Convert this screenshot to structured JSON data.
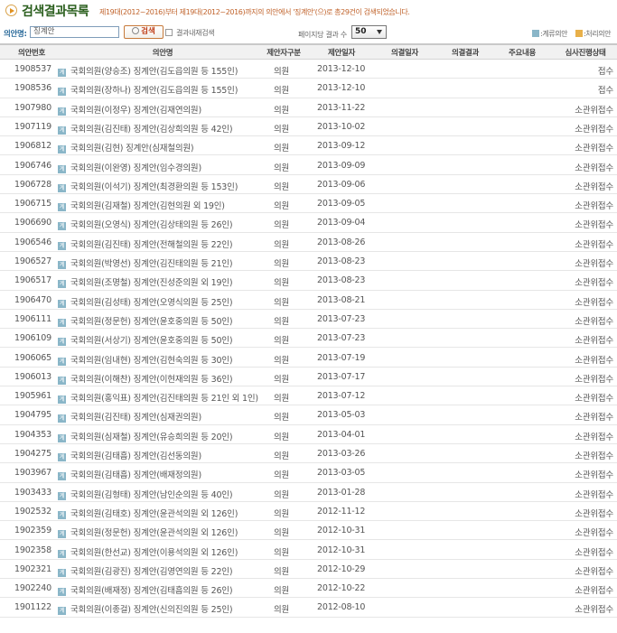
{
  "header": {
    "title": "검색결과목록",
    "description": "제19대(2012~2016)부터 제19대(2012~2016)까지의 의안에서 '징계안'(으)로 총29건이 검색되었습니다."
  },
  "search": {
    "label": "의안명:",
    "value": "징계안",
    "button_label": "검색",
    "within_label": "결과내재검색",
    "per_page_label": "페이지당 결과 수",
    "per_page_value": "50",
    "legend_pending_icon": "계",
    "legend_pending": ":계류의안",
    "legend_processed_icon": "처",
    "legend_processed": ":처리의안"
  },
  "colors": {
    "title": "#2b5f1e",
    "description": "#c0622a",
    "pending_icon": "#8ab6c8",
    "processed_icon": "#e8b04a"
  },
  "table": {
    "columns": [
      "의안번호",
      "의안명",
      "제안자구분",
      "제안일자",
      "의결일자",
      "의결결과",
      "주요내용",
      "심사진행상태"
    ],
    "rows": [
      {
        "no": "1908537",
        "icon": "계",
        "name": "국회의원(양승조) 징계안(김도읍의원 등 155인)",
        "type": "의원",
        "date": "2013-12-10",
        "status": "접수"
      },
      {
        "no": "1908536",
        "icon": "계",
        "name": "국회의원(장하나) 징계안(김도읍의원 등 155인)",
        "type": "의원",
        "date": "2013-12-10",
        "status": "접수"
      },
      {
        "no": "1907980",
        "icon": "계",
        "name": "국회의원(이정우) 징계안(김재연의원)",
        "type": "의원",
        "date": "2013-11-22",
        "status": "소관위접수"
      },
      {
        "no": "1907119",
        "icon": "계",
        "name": "국회의원(김진태) 징계안(김상희의원 등 42인)",
        "type": "의원",
        "date": "2013-10-02",
        "status": "소관위접수"
      },
      {
        "no": "1906812",
        "icon": "계",
        "name": "국회의원(김현) 징계안(심재철의원)",
        "type": "의원",
        "date": "2013-09-12",
        "status": "소관위접수"
      },
      {
        "no": "1906746",
        "icon": "계",
        "name": "국회의원(이완영) 징계안(임수경의원)",
        "type": "의원",
        "date": "2013-09-09",
        "status": "소관위접수"
      },
      {
        "no": "1906728",
        "icon": "계",
        "name": "국회의원(이석기) 징계안(최경환의원 등 153인)",
        "type": "의원",
        "date": "2013-09-06",
        "status": "소관위접수"
      },
      {
        "no": "1906715",
        "icon": "계",
        "name": "국회의원(김재철) 징계안(김현의원 외 19인)",
        "type": "의원",
        "date": "2013-09-05",
        "status": "소관위접수"
      },
      {
        "no": "1906690",
        "icon": "계",
        "name": "국회의원(오영식) 징계안(김상태의원 등 26인)",
        "type": "의원",
        "date": "2013-09-04",
        "status": "소관위접수"
      },
      {
        "no": "1906546",
        "icon": "계",
        "name": "국회의원(김진태) 징계안(전해철의원 등 22인)",
        "type": "의원",
        "date": "2013-08-26",
        "status": "소관위접수"
      },
      {
        "no": "1906527",
        "icon": "계",
        "name": "국회의원(박영선) 징계안(김진태의원 등 21인)",
        "type": "의원",
        "date": "2013-08-23",
        "status": "소관위접수"
      },
      {
        "no": "1906517",
        "icon": "계",
        "name": "국회의원(조명철) 징계안(진성준의원 외 19인)",
        "type": "의원",
        "date": "2013-08-23",
        "status": "소관위접수"
      },
      {
        "no": "1906470",
        "icon": "계",
        "name": "국회의원(김성태) 징계안(오영식의원 등 25인)",
        "type": "의원",
        "date": "2013-08-21",
        "status": "소관위접수"
      },
      {
        "no": "1906111",
        "icon": "계",
        "name": "국회의원(정문헌) 징계안(윤호중의원 등 50인)",
        "type": "의원",
        "date": "2013-07-23",
        "status": "소관위접수"
      },
      {
        "no": "1906109",
        "icon": "계",
        "name": "국회의원(서상기) 징계안(윤호중의원 등 50인)",
        "type": "의원",
        "date": "2013-07-23",
        "status": "소관위접수"
      },
      {
        "no": "1906065",
        "icon": "계",
        "name": "국회의원(임내현) 징계안(김현숙의원 등 30인)",
        "type": "의원",
        "date": "2013-07-19",
        "status": "소관위접수"
      },
      {
        "no": "1906013",
        "icon": "계",
        "name": "국회의원(이해찬) 징계안(이현재의원 등 36인)",
        "type": "의원",
        "date": "2013-07-17",
        "status": "소관위접수"
      },
      {
        "no": "1905961",
        "icon": "계",
        "name": "국회의원(홍익표) 징계안(김진태의원 등 21인 외 1인)",
        "type": "의원",
        "date": "2013-07-12",
        "status": "소관위접수"
      },
      {
        "no": "1904795",
        "icon": "계",
        "name": "국회의원(김진태) 징계안(심재권의원)",
        "type": "의원",
        "date": "2013-05-03",
        "status": "소관위접수"
      },
      {
        "no": "1904353",
        "icon": "계",
        "name": "국회의원(심재철) 징계안(유승희의원 등 20인)",
        "type": "의원",
        "date": "2013-04-01",
        "status": "소관위접수"
      },
      {
        "no": "1904275",
        "icon": "계",
        "name": "국회의원(김태흠) 징계안(김선동의원)",
        "type": "의원",
        "date": "2013-03-26",
        "status": "소관위접수"
      },
      {
        "no": "1903967",
        "icon": "계",
        "name": "국회의원(김태흠) 징계안(배재정의원)",
        "type": "의원",
        "date": "2013-03-05",
        "status": "소관위접수"
      },
      {
        "no": "1903433",
        "icon": "계",
        "name": "국회의원(김형태) 징계안(남인순의원 등 40인)",
        "type": "의원",
        "date": "2013-01-28",
        "status": "소관위접수"
      },
      {
        "no": "1902532",
        "icon": "계",
        "name": "국회의원(김태호) 징계안(윤관석의원 외 126인)",
        "type": "의원",
        "date": "2012-11-12",
        "status": "소관위접수"
      },
      {
        "no": "1902359",
        "icon": "계",
        "name": "국회의원(정문헌) 징계안(윤관석의원 외 126인)",
        "type": "의원",
        "date": "2012-10-31",
        "status": "소관위접수"
      },
      {
        "no": "1902358",
        "icon": "계",
        "name": "국회의원(한선교) 징계안(이용석의원 외 126인)",
        "type": "의원",
        "date": "2012-10-31",
        "status": "소관위접수"
      },
      {
        "no": "1902321",
        "icon": "계",
        "name": "국회의원(김광진) 징계안(김영연의원 등 22인)",
        "type": "의원",
        "date": "2012-10-29",
        "status": "소관위접수"
      },
      {
        "no": "1902240",
        "icon": "계",
        "name": "국회의원(배재정) 징계안(김태흠의원 등 26인)",
        "type": "의원",
        "date": "2012-10-22",
        "status": "소관위접수"
      },
      {
        "no": "1901122",
        "icon": "계",
        "name": "국회의원(이종걸) 징계안(신의진의원 등 25인)",
        "type": "의원",
        "date": "2012-08-10",
        "status": "소관위접수"
      }
    ]
  }
}
